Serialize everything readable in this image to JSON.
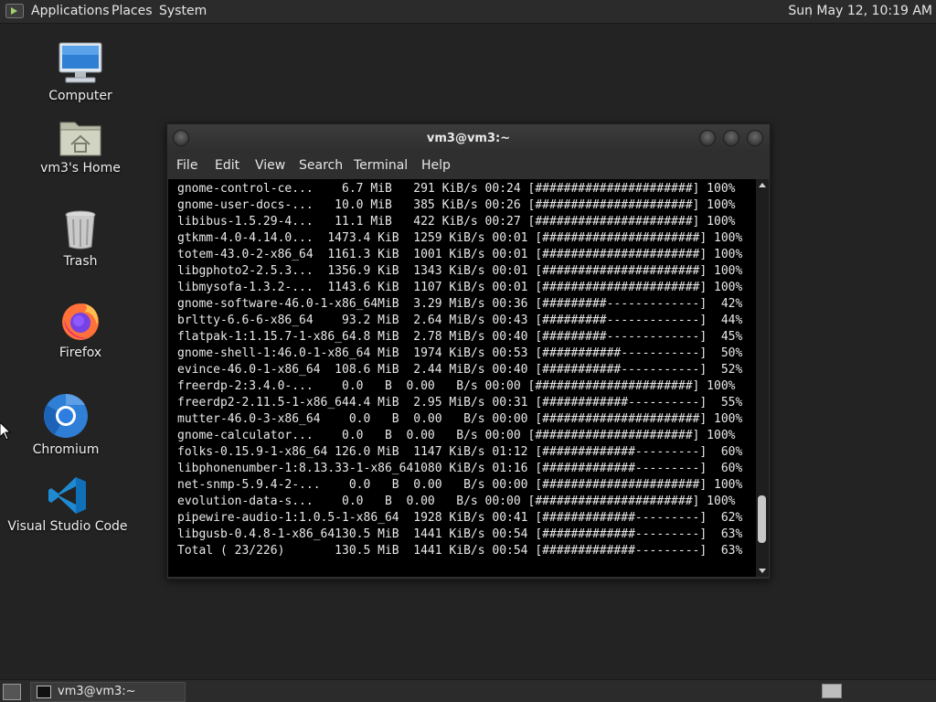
{
  "top_panel": {
    "menus": [
      "Applications",
      "Places",
      "System"
    ],
    "clock": "Sun May 12, 10:19 AM"
  },
  "desktop": {
    "icons": [
      {
        "label": "Computer",
        "icon": "computer-icon"
      },
      {
        "label": "vm3's Home",
        "icon": "home-folder-icon"
      },
      {
        "label": "Trash",
        "icon": "trash-icon"
      },
      {
        "label": "Firefox",
        "icon": "firefox-icon"
      },
      {
        "label": "Chromium",
        "icon": "chromium-icon"
      },
      {
        "label": "Visual Studio Code",
        "icon": "vscode-icon"
      }
    ]
  },
  "terminal": {
    "title": "vm3@vm3:~",
    "menu": [
      "File",
      "Edit",
      "View",
      "Search",
      "Terminal",
      "Help"
    ],
    "lines": [
      "gnome-control-ce...    6.7 MiB   291 KiB/s 00:24 [######################] 100%",
      "gnome-user-docs-...   10.0 MiB   385 KiB/s 00:26 [######################] 100%",
      "libibus-1.5.29-4...   11.1 MiB   422 KiB/s 00:27 [######################] 100%",
      "gtkmm-4.0-4.14.0...  1473.4 KiB  1259 KiB/s 00:01 [######################] 100%",
      "totem-43.0-2-x86_64  1161.3 KiB  1001 KiB/s 00:01 [######################] 100%",
      "libgphoto2-2.5.3...  1356.9 KiB  1343 KiB/s 00:01 [######################] 100%",
      "libmysofa-1.3.2-...  1143.6 KiB  1107 KiB/s 00:01 [######################] 100%",
      "gnome-software-46.0-1-x86_64MiB  3.29 MiB/s 00:36 [#########-------------]  42%",
      "brltty-6.6-6-x86_64    93.2 MiB  2.64 MiB/s 00:43 [#########-------------]  44%",
      "flatpak-1:1.15.7-1-x86_64.8 MiB  2.78 MiB/s 00:40 [#########-------------]  45%",
      "gnome-shell-1:46.0-1-x86_64 MiB  1974 KiB/s 00:53 [###########-----------]  50%",
      "evince-46.0-1-x86_64  108.6 MiB  2.44 MiB/s 00:40 [###########-----------]  52%",
      "freerdp-2:3.4.0-...    0.0   B  0.00   B/s 00:00 [######################] 100%",
      "freerdp2-2.11.5-1-x86_644.4 MiB  2.95 MiB/s 00:31 [############----------]  55%",
      "mutter-46.0-3-x86_64    0.0   B  0.00   B/s 00:00 [######################] 100%",
      "gnome-calculator...    0.0   B  0.00   B/s 00:00 [######################] 100%",
      "folks-0.15.9-1-x86_64 126.0 MiB  1147 KiB/s 01:12 [#############---------]  60%",
      "libphonenumber-1:8.13.33-1-x86_641080 KiB/s 01:16 [#############---------]  60%",
      "net-snmp-5.9.4-2-...    0.0   B  0.00   B/s 00:00 [######################] 100%",
      "evolution-data-s...    0.0   B  0.00   B/s 00:00 [######################] 100%",
      "pipewire-audio-1:1.0.5-1-x86_64  1928 KiB/s 00:41 [#############---------]  62%",
      "libgusb-0.4.8-1-x86_64130.5 MiB  1441 KiB/s 00:54 [#############---------]  63%",
      "Total ( 23/226)       130.5 MiB  1441 KiB/s 00:54 [#############---------]  63%"
    ],
    "scroll_position": 0.93
  },
  "bottom_panel": {
    "task_label": "vm3@vm3:~"
  }
}
